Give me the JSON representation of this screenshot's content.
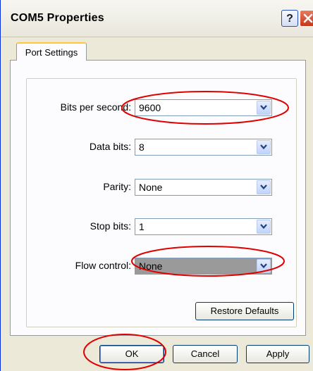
{
  "window": {
    "title": "COM5 Properties",
    "help_label": "?"
  },
  "tabs": [
    {
      "label": "Port Settings"
    }
  ],
  "fields": {
    "bits_per_second": {
      "label": "Bits per second:",
      "value": "9600"
    },
    "data_bits": {
      "label": "Data bits:",
      "value": "8"
    },
    "parity": {
      "label": "Parity:",
      "value": "None"
    },
    "stop_bits": {
      "label": "Stop bits:",
      "value": "1"
    },
    "flow_control": {
      "label": "Flow control:",
      "value": "None"
    }
  },
  "buttons": {
    "restore_defaults": "Restore Defaults",
    "ok": "OK",
    "cancel": "Cancel",
    "apply": "Apply"
  },
  "colors": {
    "annotation": "#e00000",
    "dialog_bg": "#ece9d8",
    "panel_bg": "#fcfcfe"
  }
}
